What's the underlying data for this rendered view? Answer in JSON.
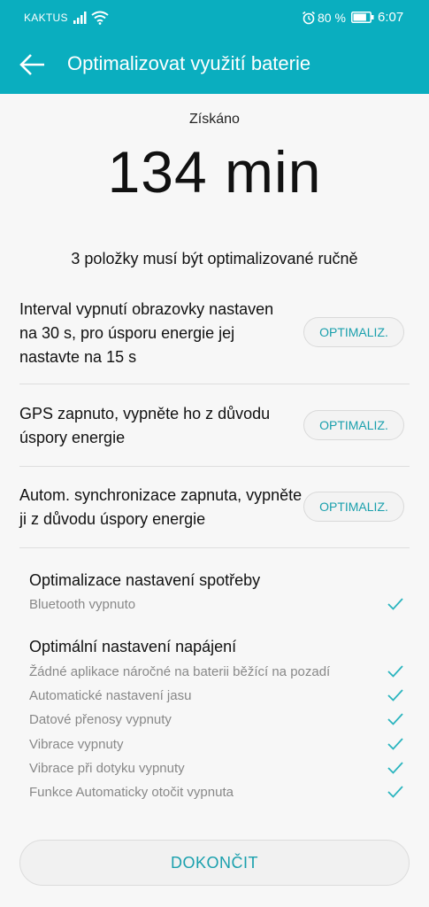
{
  "status_bar": {
    "carrier": "KAKTUS",
    "battery_percent": "80 %",
    "time": "6:07",
    "battery_level": 0.8,
    "icons": [
      "signal-icon",
      "wifi-icon",
      "alarm-icon",
      "battery-icon"
    ]
  },
  "header": {
    "title": "Optimalizovat využití baterie",
    "back_icon": "back-arrow-icon"
  },
  "summary": {
    "gained_label": "Získáno",
    "gained_value": "134 min",
    "manual_heading": "3 položky musí být optimalizované ručně"
  },
  "manual_items": [
    {
      "text": "Interval vypnutí obrazovky nastaven na 30 s, pro úsporu energie jej nastavte na 15 s",
      "button": "OPTIMALIZ."
    },
    {
      "text": "GPS zapnuto, vypněte ho z důvodu úspory energie",
      "button": "OPTIMALIZ."
    },
    {
      "text": "Autom. synchronizace zapnuta, vypněte ji z důvodu úspory energie",
      "button": "OPTIMALIZ."
    }
  ],
  "groups": [
    {
      "title": "Optimalizace nastavení spotřeby",
      "items": [
        "Bluetooth vypnuto"
      ]
    },
    {
      "title": "Optimální nastavení napájení",
      "items": [
        "Žádné aplikace náročné na baterii běžící na pozadí",
        "Automatické nastavení jasu",
        "Datové přenosy vypnuty",
        "Vibrace vypnuty",
        "Vibrace při dotyku vypnuty",
        "Funkce Automaticky otočit vypnuta"
      ]
    }
  ],
  "done_button": "DOKONČIT",
  "colors": {
    "accent": "#0aaebf",
    "button_text": "#1aa0ad",
    "check": "#2bb5bf"
  }
}
